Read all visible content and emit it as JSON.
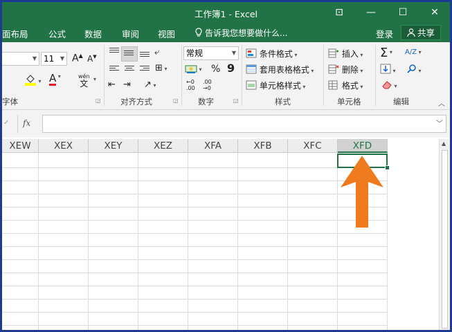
{
  "window": {
    "title": "工作簿1 - Excel",
    "controls": {
      "ribbon_display": "⊡",
      "minimize": "—",
      "maximize": "☐",
      "close": "✕"
    }
  },
  "tabs": {
    "items": [
      "面布局",
      "公式",
      "数据",
      "审阅",
      "视图"
    ],
    "tell_me": "告诉我您想要做什么...",
    "sign_in": "登录",
    "share": "共享"
  },
  "ribbon": {
    "font": {
      "size": "11",
      "increase": "A",
      "decrease": "A",
      "color_letter": "A",
      "phonetic_top": "wén",
      "phonetic_bottom": "文",
      "label": "字体"
    },
    "alignment": {
      "label": "对齐方式"
    },
    "number": {
      "format": "常规",
      "percent": "%",
      "comma": "9",
      "inc_decimal_top": "←0",
      "inc_decimal_bottom": ".00",
      "dec_decimal_top": ".00",
      "dec_decimal_bottom": "→0",
      "label": "数字"
    },
    "styles": {
      "conditional": "条件格式",
      "table": "套用表格格式",
      "cell_styles": "单元格样式",
      "label": "样式"
    },
    "cells": {
      "insert": "插入",
      "delete": "删除",
      "format": "格式",
      "label": "单元格"
    },
    "editing": {
      "sum": "Σ",
      "sort": "A/Z",
      "label": "编辑"
    }
  },
  "formula_bar": {
    "fx": "fx",
    "value": ""
  },
  "grid": {
    "columns": [
      "XEW",
      "XEX",
      "XEY",
      "XEZ",
      "XFA",
      "XFB",
      "XFC",
      "XFD"
    ],
    "selected_column": "XFD"
  },
  "colors": {
    "accent": "#217346",
    "arrow": "#f07a1e"
  }
}
